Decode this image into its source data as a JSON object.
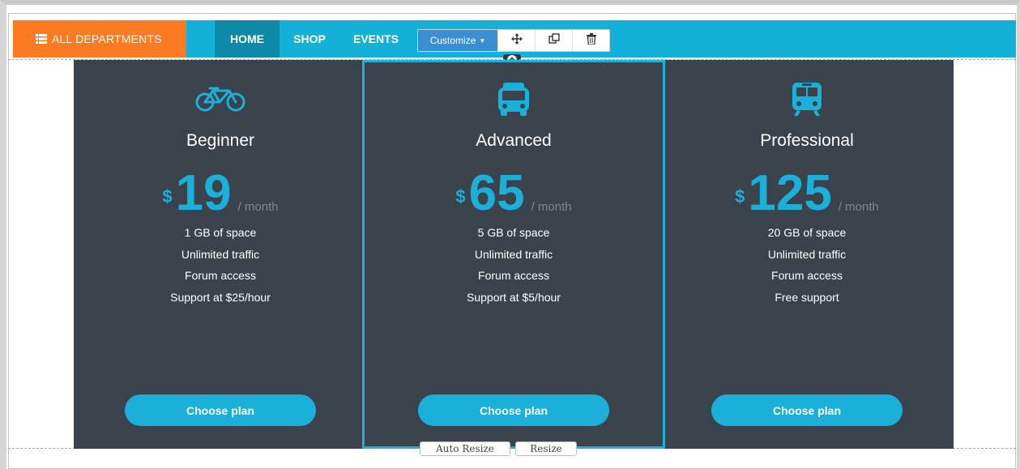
{
  "navbar": {
    "departments_label": "ALL DEPARTMENTS",
    "menu_icon": "list-icon",
    "items": [
      {
        "label": "HOME",
        "active": true
      },
      {
        "label": "SHOP",
        "active": false
      },
      {
        "label": "EVENTS",
        "active": false
      }
    ]
  },
  "toolbar": {
    "customize_label": "Customize",
    "icons": [
      "move-icon",
      "duplicate-icon",
      "trash-icon"
    ]
  },
  "plans": [
    {
      "icon": "bicycle-icon",
      "name": "Beginner",
      "currency": "$",
      "price": "19",
      "period": "/ month",
      "features": [
        "1 GB of space",
        "Unlimited traffic",
        "Forum access",
        "Support at $25/hour"
      ],
      "button": "Choose plan"
    },
    {
      "icon": "bus-icon",
      "name": "Advanced",
      "currency": "$",
      "price": "65",
      "period": "/ month",
      "features": [
        "5 GB of space",
        "Unlimited traffic",
        "Forum access",
        "Support at $5/hour"
      ],
      "button": "Choose plan"
    },
    {
      "icon": "train-icon",
      "name": "Professional",
      "currency": "$",
      "price": "125",
      "period": "/ month",
      "features": [
        "20 GB of space",
        "Unlimited traffic",
        "Forum access",
        "Free support"
      ],
      "button": "Choose plan"
    }
  ],
  "resize": {
    "auto_label": "Auto Resize",
    "resize_label": "Resize"
  },
  "colors": {
    "navbar": "#13b1d7",
    "departments": "#fb7b22",
    "active_nav": "#0d8aa8",
    "panel": "#3a424c",
    "accent": "#1ab0d9"
  }
}
